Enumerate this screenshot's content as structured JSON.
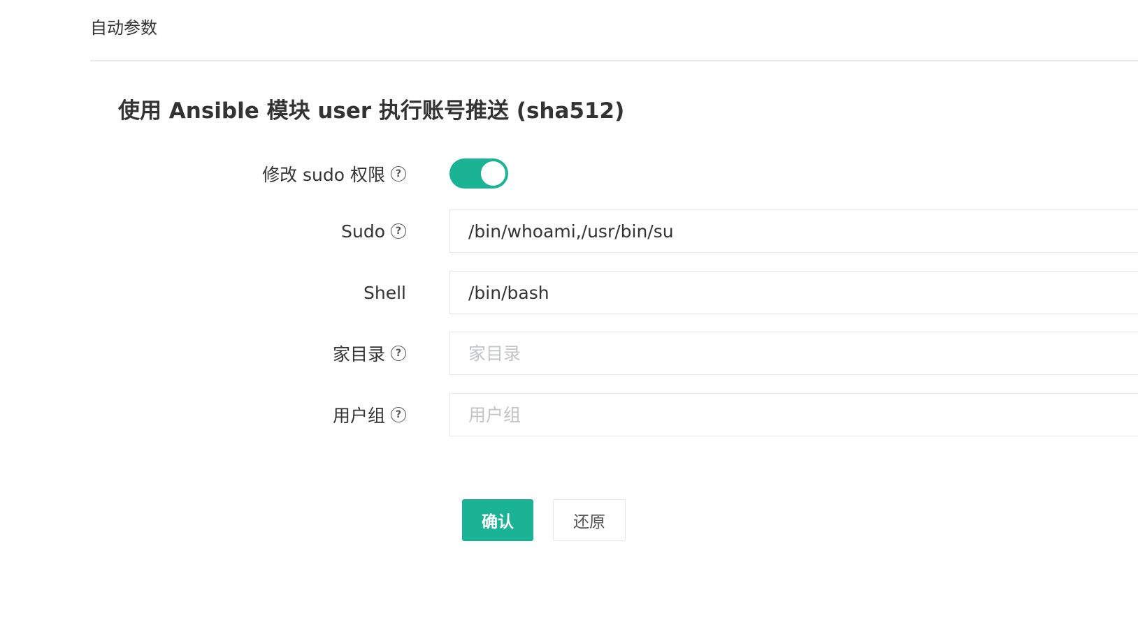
{
  "section": {
    "header": "自动参数"
  },
  "form": {
    "title": "使用 Ansible 模块 user 执行账号推送 (sha512)",
    "fields": {
      "modify_sudo": {
        "label": "修改 sudo 权限",
        "value": true,
        "help": "?"
      },
      "sudo": {
        "label": "Sudo",
        "value": "/bin/whoami,/usr/bin/su",
        "help": "?"
      },
      "shell": {
        "label": "Shell",
        "value": "/bin/bash"
      },
      "home": {
        "label": "家目录",
        "value": "",
        "placeholder": "家目录",
        "help": "?"
      },
      "groups": {
        "label": "用户组",
        "value": "",
        "placeholder": "用户组",
        "help": "?"
      }
    },
    "buttons": {
      "confirm": "确认",
      "reset": "还原"
    }
  },
  "colors": {
    "accent": "#1ab394",
    "border": "#e5e6e7",
    "placeholder": "#c2c4c6"
  }
}
